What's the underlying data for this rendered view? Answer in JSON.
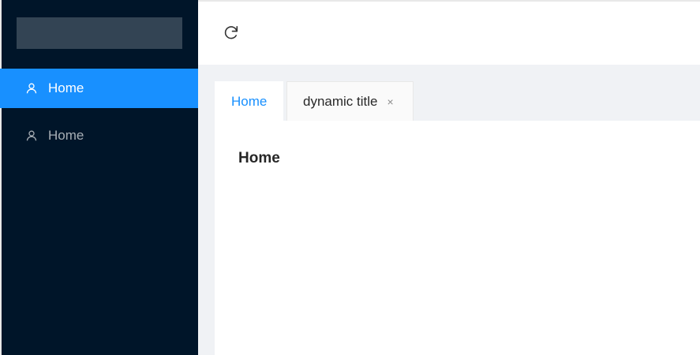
{
  "sidebar": {
    "items": [
      {
        "label": "Home",
        "icon": "user-icon",
        "active": true
      },
      {
        "label": "Home",
        "icon": "user-icon",
        "active": false
      }
    ]
  },
  "header": {
    "reload_icon": "reload-icon"
  },
  "tabs": [
    {
      "label": "Home",
      "active": true,
      "closable": false
    },
    {
      "label": "dynamic title",
      "active": false,
      "closable": true,
      "close_glyph": "×"
    }
  ],
  "main": {
    "title": "Home"
  },
  "colors": {
    "sidebar_bg": "#001529",
    "accent": "#1890ff",
    "content_bg": "#f0f2f5",
    "logo_placeholder": "#334454"
  }
}
